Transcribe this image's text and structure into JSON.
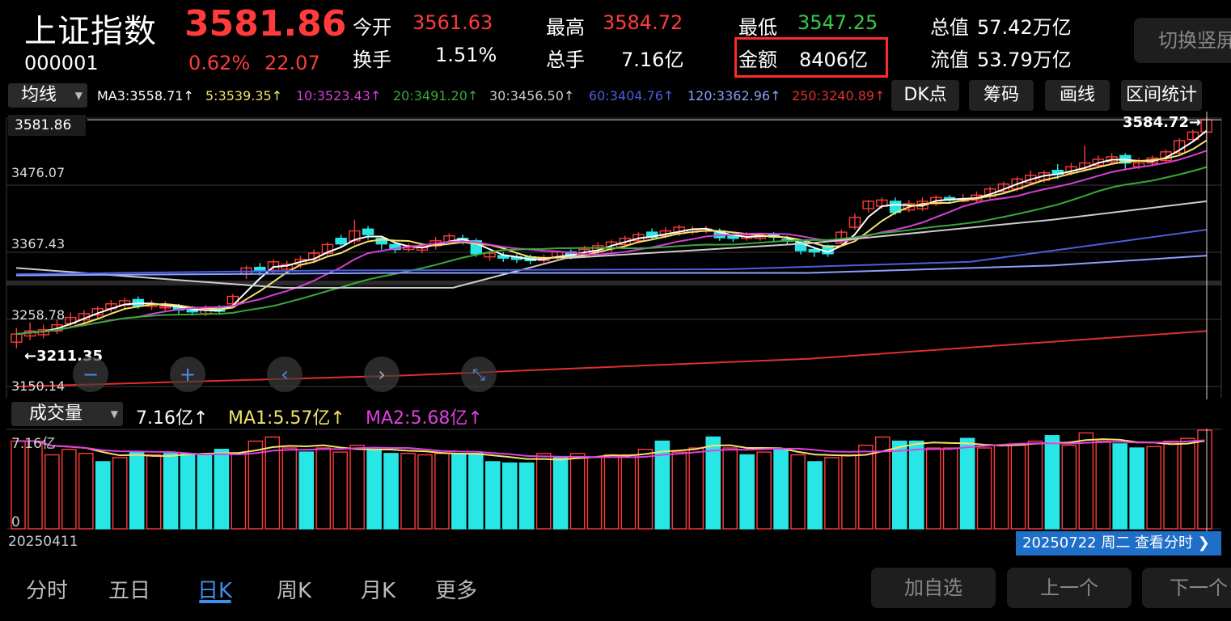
{
  "header": {
    "name": "上证指数",
    "code": "000001",
    "price": "3581.86",
    "change_pct": "0.62%",
    "change": "22.07",
    "quotes": [
      {
        "label": "今开",
        "value": "3561.63",
        "color": "#ff3b3b"
      },
      {
        "label": "换手",
        "value": "1.51%",
        "color": "#ffffff"
      },
      {
        "label": "最高",
        "value": "3584.72",
        "color": "#ff3b3b"
      },
      {
        "label": "总手",
        "value": "7.16亿",
        "color": "#ffffff"
      },
      {
        "label": "最低",
        "value": "3547.25",
        "color": "#37c84a"
      },
      {
        "label": "金额",
        "value": "8406亿",
        "color": "#ffffff"
      },
      {
        "label": "总值",
        "value": "57.42万亿",
        "color": "#ffffff"
      },
      {
        "label": "流值",
        "value": "53.79万亿",
        "color": "#ffffff"
      }
    ],
    "switch_button": "切换竖屏"
  },
  "ma_bar": {
    "select_label": "均线",
    "items": [
      {
        "text": "MA3:3558.71↑",
        "color": "#ffffff"
      },
      {
        "text": "5:3539.35↑",
        "color": "#f2e36b"
      },
      {
        "text": "10:3523.43↑",
        "color": "#d63fd6"
      },
      {
        "text": "20:3491.20↑",
        "color": "#3aa83a"
      },
      {
        "text": "30:3456.50↑",
        "color": "#cccccc"
      },
      {
        "text": "60:3404.76↑",
        "color": "#4a5fe0"
      },
      {
        "text": "120:3362.96↑",
        "color": "#8aa0ff"
      },
      {
        "text": "250:3240.89↑",
        "color": "#e03030"
      }
    ],
    "tools": [
      "DK点",
      "筹码",
      "画线",
      "区间统计"
    ]
  },
  "chart": {
    "current_price_label": "3581.86",
    "y_labels": [
      "3476.07",
      "3367.43",
      "3258.78",
      "3150.14"
    ],
    "high_label": "3584.72→",
    "low_label": "←3211.35",
    "nav_icons": [
      "zoom-out-icon",
      "zoom-in-icon",
      "chevron-left-icon",
      "chevron-right-icon",
      "collapse-icon"
    ]
  },
  "volume": {
    "select_label": "成交量",
    "current": "7.16亿↑",
    "ma1": "MA1:5.57亿↑",
    "ma2": "MA2:5.68亿↑",
    "top_label": "7.16亿",
    "zero_label": "0"
  },
  "dates": {
    "start": "20250411",
    "current": "20250722 周二 查看分时"
  },
  "bottom_tabs": [
    "分时",
    "五日",
    "日K",
    "周K",
    "月K",
    "更多"
  ],
  "bottom_buttons": [
    "加自选",
    "上一个",
    "下一个"
  ],
  "colors": {
    "up": "#ff3b3b",
    "down": "#29e6e6",
    "accent": "#3d8fe8"
  },
  "chart_data": {
    "type": "candlestick",
    "ylim": [
      3150.14,
      3584.72
    ],
    "candles": [
      [
        3235,
        3222,
        3245,
        3212
      ],
      [
        3240,
        3232,
        3254,
        3225
      ],
      [
        3242,
        3234,
        3250,
        3228
      ],
      [
        3250,
        3240,
        3258,
        3235
      ],
      [
        3262,
        3252,
        3270,
        3246
      ],
      [
        3268,
        3258,
        3274,
        3252
      ],
      [
        3276,
        3266,
        3280,
        3260
      ],
      [
        3284,
        3276,
        3290,
        3270
      ],
      [
        3289,
        3282,
        3294,
        3276
      ],
      [
        3281,
        3291,
        3296,
        3276
      ],
      [
        3284,
        3280,
        3290,
        3274
      ],
      [
        3280,
        3278,
        3288,
        3272
      ],
      [
        3274,
        3280,
        3284,
        3268
      ],
      [
        3271,
        3276,
        3280,
        3265
      ],
      [
        3276,
        3268,
        3282,
        3264
      ],
      [
        3272,
        3278,
        3282,
        3266
      ],
      [
        3296,
        3284,
        3300,
        3278
      ],
      [
        3342,
        3332,
        3346,
        3324
      ],
      [
        3337,
        3343,
        3350,
        3330
      ],
      [
        3352,
        3338,
        3356,
        3332
      ],
      [
        3348,
        3340,
        3354,
        3334
      ],
      [
        3356,
        3348,
        3362,
        3342
      ],
      [
        3366,
        3355,
        3372,
        3350
      ],
      [
        3380,
        3366,
        3384,
        3362
      ],
      [
        3381,
        3390,
        3396,
        3376
      ],
      [
        3402,
        3386,
        3420,
        3380
      ],
      [
        3396,
        3405,
        3410,
        3388
      ],
      [
        3381,
        3390,
        3394,
        3372
      ],
      [
        3372,
        3380,
        3384,
        3366
      ],
      [
        3378,
        3372,
        3382,
        3368
      ],
      [
        3375,
        3371,
        3382,
        3366
      ],
      [
        3386,
        3378,
        3392,
        3372
      ],
      [
        3394,
        3384,
        3398,
        3380
      ],
      [
        3386,
        3390,
        3396,
        3380
      ],
      [
        3365,
        3386,
        3390,
        3360
      ],
      [
        3366,
        3360,
        3370,
        3354
      ],
      [
        3358,
        3362,
        3368,
        3352
      ],
      [
        3356,
        3360,
        3364,
        3350
      ],
      [
        3354,
        3360,
        3364,
        3348
      ],
      [
        3358,
        3354,
        3364,
        3350
      ],
      [
        3368,
        3360,
        3370,
        3354
      ],
      [
        3362,
        3368,
        3372,
        3356
      ],
      [
        3372,
        3362,
        3378,
        3358
      ],
      [
        3378,
        3368,
        3384,
        3364
      ],
      [
        3384,
        3374,
        3388,
        3368
      ],
      [
        3390,
        3380,
        3394,
        3376
      ],
      [
        3396,
        3386,
        3400,
        3382
      ],
      [
        3392,
        3400,
        3406,
        3388
      ],
      [
        3402,
        3394,
        3408,
        3390
      ],
      [
        3408,
        3398,
        3412,
        3394
      ],
      [
        3404,
        3400,
        3410,
        3396
      ],
      [
        3405,
        3402,
        3410,
        3398
      ],
      [
        3391,
        3402,
        3406,
        3386
      ],
      [
        3390,
        3394,
        3398,
        3384
      ],
      [
        3396,
        3390,
        3400,
        3386
      ],
      [
        3394,
        3390,
        3398,
        3386
      ],
      [
        3392,
        3396,
        3400,
        3384
      ],
      [
        3386,
        3388,
        3394,
        3380
      ],
      [
        3370,
        3384,
        3388,
        3364
      ],
      [
        3368,
        3372,
        3374,
        3360
      ],
      [
        3365,
        3378,
        3380,
        3360
      ],
      [
        3400,
        3382,
        3404,
        3378
      ],
      [
        3424,
        3408,
        3430,
        3404
      ],
      [
        3450,
        3438,
        3452,
        3432
      ],
      [
        3452,
        3442,
        3456,
        3438
      ],
      [
        3432,
        3450,
        3456,
        3428
      ],
      [
        3446,
        3436,
        3452,
        3432
      ],
      [
        3450,
        3438,
        3456,
        3434
      ],
      [
        3456,
        3446,
        3460,
        3442
      ],
      [
        3452,
        3456,
        3460,
        3446
      ],
      [
        3454,
        3450,
        3462,
        3448
      ],
      [
        3460,
        3452,
        3466,
        3448
      ],
      [
        3470,
        3458,
        3474,
        3454
      ],
      [
        3478,
        3466,
        3482,
        3462
      ],
      [
        3486,
        3470,
        3490,
        3466
      ],
      [
        3492,
        3480,
        3500,
        3476
      ],
      [
        3496,
        3484,
        3500,
        3480
      ],
      [
        3494,
        3500,
        3510,
        3486
      ],
      [
        3506,
        3496,
        3512,
        3492
      ],
      [
        3512,
        3502,
        3540,
        3498
      ],
      [
        3518,
        3508,
        3524,
        3504
      ],
      [
        3522,
        3514,
        3528,
        3510
      ],
      [
        3512,
        3524,
        3528,
        3500
      ],
      [
        3512,
        3506,
        3520,
        3502
      ],
      [
        3520,
        3512,
        3524,
        3506
      ],
      [
        3530,
        3516,
        3534,
        3512
      ],
      [
        3548,
        3528,
        3552,
        3524
      ],
      [
        3562,
        3550,
        3566,
        3546
      ],
      [
        3582,
        3562,
        3585,
        3547
      ]
    ],
    "volumes": [
      [
        6.4,
        1
      ],
      [
        6.4,
        1
      ],
      [
        5.4,
        1
      ],
      [
        5.8,
        1
      ],
      [
        5.5,
        1
      ],
      [
        4.9,
        0
      ],
      [
        5.2,
        1
      ],
      [
        5.6,
        0
      ],
      [
        5.4,
        1
      ],
      [
        5.5,
        0
      ],
      [
        5.5,
        0
      ],
      [
        5.4,
        0
      ],
      [
        5.8,
        0
      ],
      [
        5.5,
        1
      ],
      [
        6.4,
        1
      ],
      [
        6.7,
        1
      ],
      [
        5.9,
        1
      ],
      [
        5.6,
        0
      ],
      [
        5.9,
        1
      ],
      [
        5.6,
        1
      ],
      [
        6.1,
        1
      ],
      [
        5.8,
        0
      ],
      [
        5.5,
        0
      ],
      [
        5.5,
        1
      ],
      [
        5.4,
        1
      ],
      [
        5.5,
        1
      ],
      [
        5.5,
        0
      ],
      [
        5.5,
        0
      ],
      [
        4.9,
        0
      ],
      [
        4.8,
        0
      ],
      [
        4.8,
        0
      ],
      [
        5.5,
        1
      ],
      [
        5.2,
        0
      ],
      [
        5.5,
        1
      ],
      [
        5.2,
        1
      ],
      [
        5.4,
        1
      ],
      [
        5.4,
        1
      ],
      [
        5.8,
        1
      ],
      [
        6.4,
        0
      ],
      [
        5.6,
        1
      ],
      [
        5.9,
        1
      ],
      [
        6.7,
        0
      ],
      [
        5.9,
        1
      ],
      [
        5.4,
        0
      ],
      [
        5.6,
        1
      ],
      [
        5.8,
        0
      ],
      [
        5.4,
        1
      ],
      [
        4.9,
        0
      ],
      [
        5.2,
        1
      ],
      [
        5.4,
        1
      ],
      [
        6.1,
        1
      ],
      [
        6.7,
        1
      ],
      [
        6.4,
        0
      ],
      [
        6.4,
        0
      ],
      [
        5.9,
        1
      ],
      [
        5.9,
        1
      ],
      [
        6.6,
        0
      ],
      [
        5.9,
        1
      ],
      [
        6.1,
        1
      ],
      [
        6.1,
        1
      ],
      [
        6.4,
        1
      ],
      [
        6.8,
        0
      ],
      [
        6.1,
        1
      ],
      [
        7.0,
        1
      ],
      [
        6.4,
        1
      ],
      [
        6.2,
        0
      ],
      [
        5.9,
        0
      ],
      [
        6.0,
        1
      ],
      [
        6.4,
        1
      ],
      [
        6.6,
        1
      ],
      [
        7.2,
        1
      ]
    ],
    "ma_series": {
      "MA5": {
        "color": "#f2e36b"
      },
      "MA10": {
        "color": "#d63fd6"
      },
      "MA20": {
        "color": "#3aa83a"
      },
      "MA30": {
        "color": "#cccccc"
      },
      "MA60": {
        "color": "#4a5fe0"
      },
      "MA120": {
        "color": "#8aa0ff"
      },
      "MA250": {
        "color": "#e03030"
      }
    }
  }
}
